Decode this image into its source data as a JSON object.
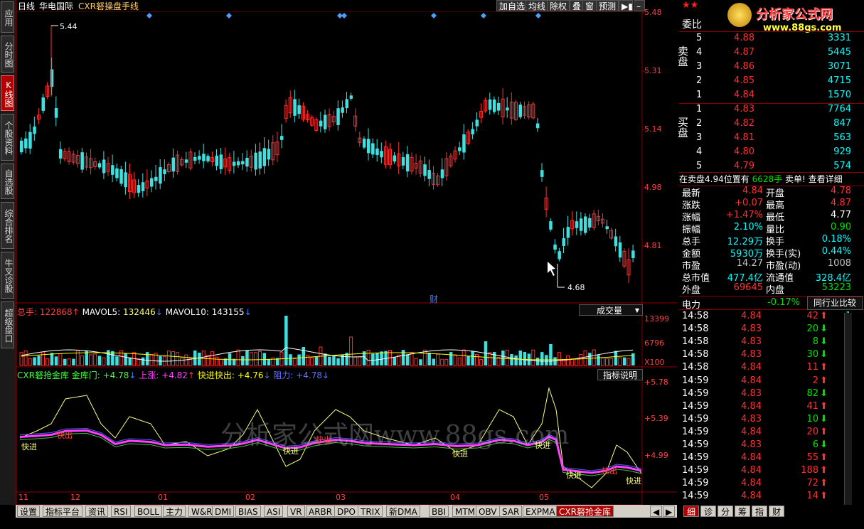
{
  "sidebar": {
    "items": [
      {
        "label": "应用"
      },
      {
        "label": "分时图"
      },
      {
        "label": "K线图"
      },
      {
        "label": "个股资料"
      },
      {
        "label": "自选股"
      },
      {
        "label": "综合排名"
      },
      {
        "label": "牛叉诊股"
      },
      {
        "label": "超级盘口"
      }
    ]
  },
  "header": {
    "period": "日线",
    "stock_name": "华电国际",
    "indicator_name": "CXR砮操盘手线",
    "buttons": [
      "加自选",
      "均线",
      "除权",
      "叠",
      "窗",
      "预测"
    ],
    "arrow_icon": "arrow-right-icon",
    "minimize_icon": "minimize-icon"
  },
  "price_axis": [
    "5.48",
    "5.31",
    "5.14",
    "4.98",
    "4.81"
  ],
  "price_marks": {
    "high": "5.44",
    "low": "4.68"
  },
  "finance_marker": "财",
  "volume_panel": {
    "legend": [
      {
        "label": "总手: ",
        "value": "122868",
        "arrow": "↑"
      },
      {
        "label": "MAVOL5: ",
        "value": "132446",
        "arrow": "↓"
      },
      {
        "label": "MAVOL10: ",
        "value": "143155",
        "arrow": "↓"
      }
    ],
    "dropdown": "成交量",
    "axis": [
      "13399",
      "6796"
    ],
    "unit": "X100"
  },
  "indicator_panel": {
    "legend": [
      {
        "label": "CXR砮抢金库 金库门: ",
        "value": "+4.78",
        "arrow": "↓"
      },
      {
        "label": "上涨: ",
        "value": "+4.82",
        "arrow": "↑"
      },
      {
        "label": "快进快出: ",
        "value": "+4.76",
        "arrow": "↓"
      },
      {
        "label": "阻力: ",
        "value": "+4.78",
        "arrow": "↓"
      }
    ],
    "help_button": "指标说明",
    "axis": [
      "+5.78",
      "+5.39",
      "+4.99"
    ],
    "annotations": {
      "fast_in": "快进",
      "fast_out": "快出"
    },
    "watermark": "分析家公式网www.88gs.com"
  },
  "date_axis": [
    "11",
    "12",
    "01",
    "02",
    "03",
    "04",
    "05"
  ],
  "tabs": [
    "设置",
    "指标平台",
    "资讯",
    "RSI",
    "BOLL",
    "主力",
    "W&R",
    "DMI",
    "BIAS",
    "ASI",
    "VR",
    "ARBR",
    "DPO",
    "TRIX",
    "新DMA",
    "BBI",
    "MTM",
    "OBV",
    "SAR",
    "EXPMA",
    "CXR砮抢金库"
  ],
  "right_panel": {
    "logo_text": "分析家公式网",
    "logo_url": "www.88gs.com",
    "weibi_label": "委比",
    "sell_label": "卖盘",
    "buy_label": "买盘",
    "asks": [
      {
        "level": "5",
        "price": "4.88",
        "vol": "3331"
      },
      {
        "level": "4",
        "price": "4.87",
        "vol": "5445"
      },
      {
        "level": "3",
        "price": "4.86",
        "vol": "3071"
      },
      {
        "level": "2",
        "price": "4.85",
        "vol": "4715"
      },
      {
        "level": "1",
        "price": "4.84",
        "vol": "1570"
      }
    ],
    "bids": [
      {
        "level": "1",
        "price": "4.83",
        "vol": "7764"
      },
      {
        "level": "2",
        "price": "4.82",
        "vol": "847"
      },
      {
        "level": "3",
        "price": "4.81",
        "vol": "563"
      },
      {
        "level": "4",
        "price": "4.80",
        "vol": "929"
      },
      {
        "level": "5",
        "price": "4.79",
        "vol": "574"
      }
    ],
    "queue": {
      "text": "在卖盘4.94位置有",
      "volume": "6628手",
      "suffix": "卖单!",
      "link": "查看详细"
    },
    "stats": [
      {
        "l1": "最新",
        "v1": "4.84",
        "c1": "red",
        "l2": "开盘",
        "v2": "4.78",
        "c2": "red"
      },
      {
        "l1": "涨跌",
        "v1": "+0.07",
        "c1": "red",
        "l2": "最高",
        "v2": "4.87",
        "c2": "red"
      },
      {
        "l1": "涨幅",
        "v1": "+1.47%",
        "c1": "red",
        "l2": "最低",
        "v2": "4.77",
        "c2": "white"
      },
      {
        "l1": "振幅",
        "v1": "2.10%",
        "c1": "cyan",
        "l2": "量比",
        "v2": "0.90",
        "c2": "green"
      },
      {
        "l1": "总手",
        "v1": "12.29万",
        "c1": "cyan",
        "l2": "换手",
        "v2": "0.18%",
        "c2": "cyan"
      },
      {
        "l1": "金额",
        "v1": "5930万",
        "c1": "cyan",
        "l2": "换手(实)",
        "v2": "0.44%",
        "c2": "cyan"
      },
      {
        "l1": "市盈",
        "v1": "14.27",
        "c1": "gray",
        "l2": "市盈(动)",
        "v2": "1008",
        "c2": "gray"
      },
      {
        "l1": "总市值",
        "v1": "477.4亿",
        "c1": "cyan",
        "l2": "流通值",
        "v2": "328.4亿",
        "c2": "cyan"
      },
      {
        "l1": "外盘",
        "v1": "69645",
        "c1": "red",
        "l2": "内盘",
        "v2": "53223",
        "c2": "green"
      }
    ],
    "sector": {
      "name": "电力",
      "change": "-0.17%",
      "button": "同行业比较"
    },
    "ticks": [
      {
        "time": "14:58",
        "price": "4.84",
        "pc": "red",
        "vol": "42",
        "dir": "up",
        "n": "1"
      },
      {
        "time": "14:58",
        "price": "4.83",
        "pc": "red",
        "vol": "20",
        "dir": "down",
        "n": "1"
      },
      {
        "time": "14:58",
        "price": "4.83",
        "pc": "red",
        "vol": "8",
        "dir": "down",
        "n": "1"
      },
      {
        "time": "14:58",
        "price": "4.83",
        "pc": "red",
        "vol": "30",
        "dir": "down",
        "n": "1"
      },
      {
        "time": "14:58",
        "price": "4.84",
        "pc": "red",
        "vol": "11",
        "dir": "up",
        "n": "1"
      },
      {
        "time": "14:59",
        "price": "4.84",
        "pc": "red",
        "vol": "2",
        "dir": "up",
        "n": "1"
      },
      {
        "time": "14:59",
        "price": "4.83",
        "pc": "red",
        "vol": "82",
        "dir": "down",
        "n": "1"
      },
      {
        "time": "14:59",
        "price": "4.84",
        "pc": "red",
        "vol": "41",
        "dir": "up",
        "n": "1"
      },
      {
        "time": "14:59",
        "price": "4.83",
        "pc": "red",
        "vol": "10",
        "dir": "down",
        "n": "1"
      },
      {
        "time": "14:59",
        "price": "4.84",
        "pc": "red",
        "vol": "20",
        "dir": "up",
        "n": "1"
      },
      {
        "time": "14:59",
        "price": "4.83",
        "pc": "red",
        "vol": "6",
        "dir": "down",
        "n": "1"
      },
      {
        "time": "14:59",
        "price": "4.84",
        "pc": "red",
        "vol": "55",
        "dir": "up",
        "n": "1"
      },
      {
        "time": "14:59",
        "price": "4.84",
        "pc": "red",
        "vol": "188",
        "dir": "up",
        "n": "1"
      },
      {
        "time": "14:59",
        "price": "4.84",
        "pc": "red",
        "vol": "72",
        "dir": "up",
        "n": "1"
      },
      {
        "time": "14:59",
        "price": "4.84",
        "pc": "red",
        "vol": "14",
        "dir": "up",
        "n": "1"
      }
    ],
    "bottom_tabs": [
      "细",
      "诊",
      "分",
      "筹",
      "指",
      "财"
    ]
  },
  "colors": {
    "up": "#ff3030",
    "down": "#40e0e0",
    "border": "#8b0000",
    "ma5": "#ffffff",
    "ma10": "#ffff00",
    "magenta": "#ff40ff",
    "blue": "#5060ff"
  }
}
